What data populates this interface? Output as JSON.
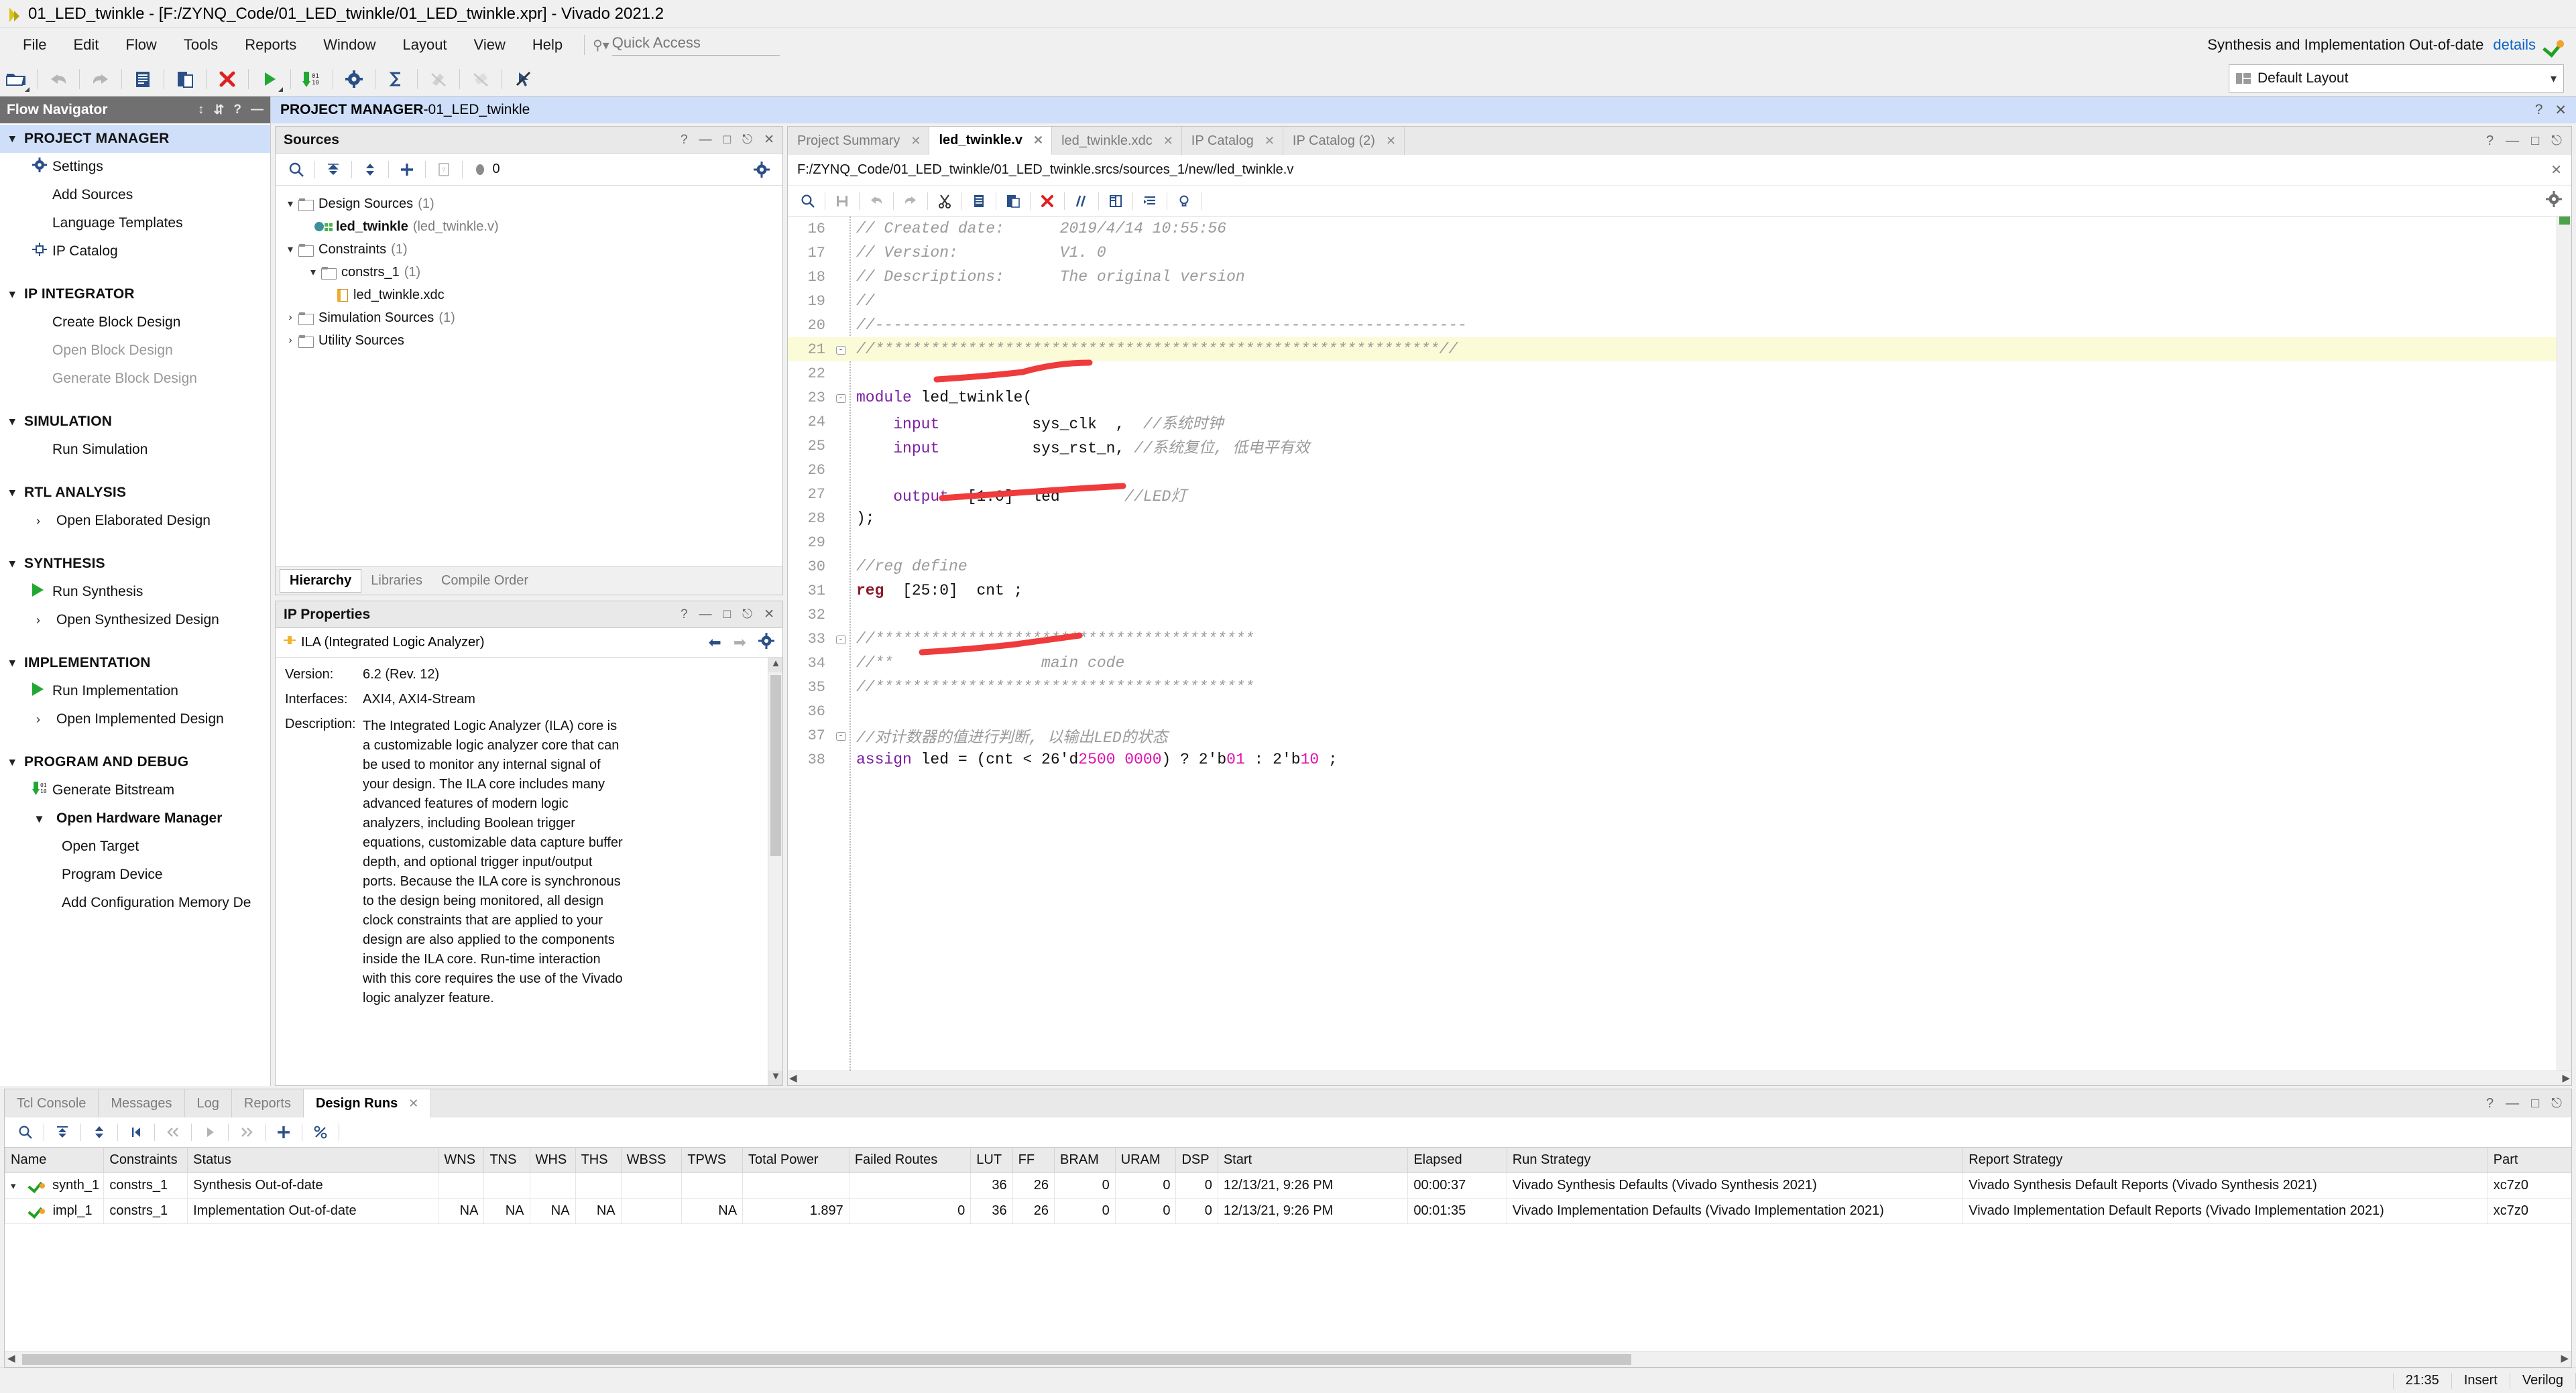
{
  "window": {
    "title": "01_LED_twinkle - [F:/ZYNQ_Code/01_LED_twinkle/01_LED_twinkle.xpr] - Vivado 2021.2"
  },
  "menubar": {
    "items": [
      "File",
      "Edit",
      "Flow",
      "Tools",
      "Reports",
      "Window",
      "Layout",
      "View",
      "Help"
    ],
    "quick_access_placeholder": "Quick Access"
  },
  "header_status": {
    "text": "Synthesis and Implementation Out-of-date",
    "details_link": "details"
  },
  "toolbar": {
    "layout_label": "Default Layout"
  },
  "flow_navigator": {
    "title": "Flow Navigator",
    "sections": [
      {
        "label": "PROJECT MANAGER",
        "items": [
          {
            "label": "Settings",
            "icon": "gear-icon"
          },
          {
            "label": "Add Sources",
            "icon": "none"
          },
          {
            "label": "Language Templates",
            "icon": "none"
          },
          {
            "label": "IP Catalog",
            "icon": "ip-icon"
          }
        ]
      },
      {
        "label": "IP INTEGRATOR",
        "items": [
          {
            "label": "Create Block Design",
            "icon": "none"
          },
          {
            "label": "Open Block Design",
            "icon": "none",
            "disabled": true
          },
          {
            "label": "Generate Block Design",
            "icon": "none",
            "disabled": true
          }
        ]
      },
      {
        "label": "SIMULATION",
        "items": [
          {
            "label": "Run Simulation",
            "icon": "none"
          }
        ]
      },
      {
        "label": "RTL ANALYSIS",
        "items": [
          {
            "label": "Open Elaborated Design",
            "icon": "chevron-right-icon"
          }
        ]
      },
      {
        "label": "SYNTHESIS",
        "items": [
          {
            "label": "Run Synthesis",
            "icon": "play-icon"
          },
          {
            "label": "Open Synthesized Design",
            "icon": "chevron-right-icon"
          }
        ]
      },
      {
        "label": "IMPLEMENTATION",
        "items": [
          {
            "label": "Run Implementation",
            "icon": "play-icon"
          },
          {
            "label": "Open Implemented Design",
            "icon": "chevron-right-icon"
          }
        ]
      },
      {
        "label": "PROGRAM AND DEBUG",
        "items": [
          {
            "label": "Generate Bitstream",
            "icon": "bitstream-icon"
          },
          {
            "label": "Open Hardware Manager",
            "icon": "chevron-down-icon",
            "bold": true
          },
          {
            "label": "Open Target",
            "icon": "none",
            "deep": true
          },
          {
            "label": "Program Device",
            "icon": "none",
            "deep": true
          },
          {
            "label": "Add Configuration Memory De",
            "icon": "none",
            "deep": true
          }
        ]
      }
    ]
  },
  "project_title": {
    "prefix": "PROJECT MANAGER",
    "separator": " - ",
    "name": "01_LED_twinkle"
  },
  "sources_panel": {
    "title": "Sources",
    "badge_count": "0",
    "tree": [
      {
        "label": "Design Sources",
        "count": "(1)",
        "indent": 0,
        "twisty": "v",
        "icon": "folder-icon"
      },
      {
        "label": "led_twinkle",
        "suffix": "(led_twinkle.v)",
        "indent": 1,
        "twisty": "",
        "icon": "verilog-file-icon",
        "bold": true
      },
      {
        "label": "Constraints",
        "count": "(1)",
        "indent": 0,
        "twisty": "v",
        "icon": "folder-icon"
      },
      {
        "label": "constrs_1",
        "count": "(1)",
        "indent": 1,
        "twisty": "v",
        "icon": "folder-icon"
      },
      {
        "label": "led_twinkle.xdc",
        "indent": 2,
        "twisty": "",
        "icon": "xdc-file-icon"
      },
      {
        "label": "Simulation Sources",
        "count": "(1)",
        "indent": 0,
        "twisty": ">",
        "icon": "folder-icon"
      },
      {
        "label": "Utility Sources",
        "indent": 0,
        "twisty": ">",
        "icon": "folder-icon"
      }
    ],
    "tabs": [
      "Hierarchy",
      "Libraries",
      "Compile Order"
    ],
    "active_tab": "Hierarchy"
  },
  "ip_properties": {
    "title": "IP Properties",
    "ip_name": "ILA (Integrated Logic Analyzer)",
    "version_label": "Version:",
    "version_value": "6.2 (Rev. 12)",
    "interfaces_label": "Interfaces:",
    "interfaces_value": "AXI4, AXI4-Stream",
    "description_label": "Description:",
    "description_value": "The Integrated Logic Analyzer (ILA) core is a customizable logic analyzer core that can be used to monitor any internal signal of your design. The ILA core includes many advanced features of modern logic analyzers, including Boolean trigger equations, customizable data capture buffer depth, and optional trigger input/output ports. Because the ILA core is synchronous to the design being monitored, all design clock constraints that are applied to your design are also applied to the components inside the ILA core. Run-time interaction with this core requires the use of the Vivado logic analyzer feature."
  },
  "editor": {
    "tabs": [
      {
        "label": "Project Summary",
        "active": false
      },
      {
        "label": "led_twinkle.v",
        "active": true
      },
      {
        "label": "led_twinkle.xdc",
        "active": false
      },
      {
        "label": "IP Catalog",
        "active": false
      },
      {
        "label": "IP Catalog (2)",
        "active": false
      }
    ],
    "path": "F:/ZYNQ_Code/01_LED_twinkle/01_LED_twinkle.srcs/sources_1/new/led_twinkle.v",
    "lines": [
      {
        "n": "16",
        "fold": "",
        "hl": false,
        "segs": [
          {
            "t": "// Created date:      2019/4/14 10:55:56",
            "c": "cm"
          }
        ]
      },
      {
        "n": "17",
        "fold": "",
        "hl": false,
        "segs": [
          {
            "t": "// Version:           V1. 0",
            "c": "cm"
          }
        ]
      },
      {
        "n": "18",
        "fold": "",
        "hl": false,
        "segs": [
          {
            "t": "// Descriptions:      The original version",
            "c": "cm"
          }
        ]
      },
      {
        "n": "19",
        "fold": "",
        "hl": false,
        "segs": [
          {
            "t": "//",
            "c": "cm"
          }
        ]
      },
      {
        "n": "20",
        "fold": "",
        "hl": false,
        "segs": [
          {
            "t": "//----------------------------------------------------------------",
            "c": "cm"
          }
        ]
      },
      {
        "n": "21",
        "fold": "-",
        "hl": true,
        "segs": [
          {
            "t": "//*************************************************************//",
            "c": "cm"
          }
        ]
      },
      {
        "n": "22",
        "fold": "",
        "hl": false,
        "segs": []
      },
      {
        "n": "23",
        "fold": "-",
        "hl": false,
        "segs": [
          {
            "t": "module",
            "c": "kw"
          },
          {
            "t": " led_twinkle(",
            "c": "plain"
          }
        ]
      },
      {
        "n": "24",
        "fold": "",
        "hl": false,
        "segs": [
          {
            "t": "    ",
            "c": "plain"
          },
          {
            "t": "input",
            "c": "kw"
          },
          {
            "t": "          sys_clk  ,  ",
            "c": "plain"
          },
          {
            "t": "//系统时钟",
            "c": "cm"
          }
        ]
      },
      {
        "n": "25",
        "fold": "",
        "hl": false,
        "segs": [
          {
            "t": "    ",
            "c": "plain"
          },
          {
            "t": "input",
            "c": "kw"
          },
          {
            "t": "          sys_rst_n, ",
            "c": "plain"
          },
          {
            "t": "//系统复位, 低电平有效",
            "c": "cm"
          }
        ]
      },
      {
        "n": "26",
        "fold": "",
        "hl": false,
        "segs": []
      },
      {
        "n": "27",
        "fold": "",
        "hl": false,
        "segs": [
          {
            "t": "    ",
            "c": "plain"
          },
          {
            "t": "output",
            "c": "kw"
          },
          {
            "t": "  [1:0]  led       ",
            "c": "plain"
          },
          {
            "t": "//LED灯",
            "c": "cm"
          }
        ]
      },
      {
        "n": "28",
        "fold": "",
        "hl": false,
        "segs": [
          {
            "t": ");",
            "c": "plain"
          }
        ]
      },
      {
        "n": "29",
        "fold": "",
        "hl": false,
        "segs": []
      },
      {
        "n": "30",
        "fold": "",
        "hl": false,
        "segs": [
          {
            "t": "//reg define",
            "c": "cm"
          }
        ]
      },
      {
        "n": "31",
        "fold": "",
        "hl": false,
        "segs": [
          {
            "t": "reg",
            "c": "kw2"
          },
          {
            "t": "  [25:0]  cnt ;",
            "c": "plain"
          }
        ]
      },
      {
        "n": "32",
        "fold": "",
        "hl": false,
        "segs": []
      },
      {
        "n": "33",
        "fold": "-",
        "hl": false,
        "segs": [
          {
            "t": "//*****************************************",
            "c": "cm"
          }
        ]
      },
      {
        "n": "34",
        "fold": "",
        "hl": false,
        "segs": [
          {
            "t": "//**                main code",
            "c": "cm"
          }
        ]
      },
      {
        "n": "35",
        "fold": "",
        "hl": false,
        "segs": [
          {
            "t": "//*****************************************",
            "c": "cm"
          }
        ]
      },
      {
        "n": "36",
        "fold": "",
        "hl": false,
        "segs": []
      },
      {
        "n": "37",
        "fold": "-",
        "hl": false,
        "segs": [
          {
            "t": "//对计数器的值进行判断, 以输出LED的状态",
            "c": "cm"
          }
        ]
      },
      {
        "n": "38",
        "fold": "",
        "hl": false,
        "segs": [
          {
            "t": "assign",
            "c": "kw"
          },
          {
            "t": " led = (cnt < 26'd",
            "c": "plain"
          },
          {
            "t": "2500 0000",
            "c": "num"
          },
          {
            "t": ") ? 2'b",
            "c": "plain"
          },
          {
            "t": "01",
            "c": "num"
          },
          {
            "t": " : 2'b",
            "c": "plain"
          },
          {
            "t": "10",
            "c": "num"
          },
          {
            "t": " ;",
            "c": "plain"
          }
        ]
      }
    ]
  },
  "bottom_dock": {
    "tabs": [
      "Tcl Console",
      "Messages",
      "Log",
      "Reports",
      "Design Runs"
    ],
    "active_tab": "Design Runs",
    "columns": [
      "Name",
      "Constraints",
      "Status",
      "WNS",
      "TNS",
      "WHS",
      "THS",
      "WBSS",
      "TPWS",
      "Total Power",
      "Failed Routes",
      "LUT",
      "FF",
      "BRAM",
      "URAM",
      "DSP",
      "Start",
      "Elapsed",
      "Run Strategy",
      "Report Strategy",
      "Part"
    ],
    "rows": [
      {
        "twisty": "v",
        "indent": 0,
        "Name": "synth_1",
        "Constraints": "constrs_1",
        "Status": "Synthesis Out-of-date",
        "WNS": "",
        "TNS": "",
        "WHS": "",
        "THS": "",
        "WBSS": "",
        "TPWS": "",
        "Total Power": "",
        "Failed Routes": "",
        "LUT": "36",
        "FF": "26",
        "BRAM": "0",
        "URAM": "0",
        "DSP": "0",
        "Start": "12/13/21, 9:26 PM",
        "Elapsed": "00:00:37",
        "Run Strategy": "Vivado Synthesis Defaults (Vivado Synthesis 2021)",
        "Report Strategy": "Vivado Synthesis Default Reports (Vivado Synthesis 2021)",
        "Part": "xc7z0"
      },
      {
        "twisty": "",
        "indent": 1,
        "Name": "impl_1",
        "Constraints": "constrs_1",
        "Status": "Implementation Out-of-date",
        "WNS": "NA",
        "TNS": "NA",
        "WHS": "NA",
        "THS": "NA",
        "WBSS": "",
        "TPWS": "NA",
        "Total Power": "1.897",
        "Failed Routes": "0",
        "LUT": "36",
        "FF": "26",
        "BRAM": "0",
        "URAM": "0",
        "DSP": "0",
        "Start": "12/13/21, 9:26 PM",
        "Elapsed": "00:01:35",
        "Run Strategy": "Vivado Implementation Defaults (Vivado Implementation 2021)",
        "Report Strategy": "Vivado Implementation Default Reports (Vivado Implementation 2021)",
        "Part": "xc7z0"
      }
    ]
  },
  "statusbar": {
    "time": "21:35",
    "mode": "Insert",
    "language": "Verilog"
  }
}
